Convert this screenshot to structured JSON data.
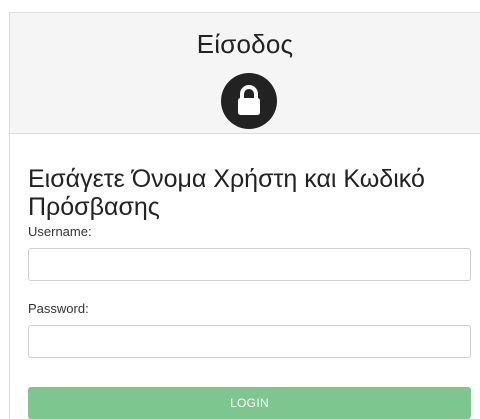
{
  "header": {
    "title": "Είσοδος",
    "icon": "lock-icon"
  },
  "form": {
    "heading": "Εισάγετε Όνομα Χρήστη και Κωδικό Πρόσβασης",
    "username_label": "Username:",
    "username_value": "",
    "password_label": "Password:",
    "password_value": "",
    "submit_label": "LOGIN"
  },
  "colors": {
    "header_background": "#f5f5f5",
    "lock_badge": "#222222",
    "login_button": "#7ec690"
  }
}
